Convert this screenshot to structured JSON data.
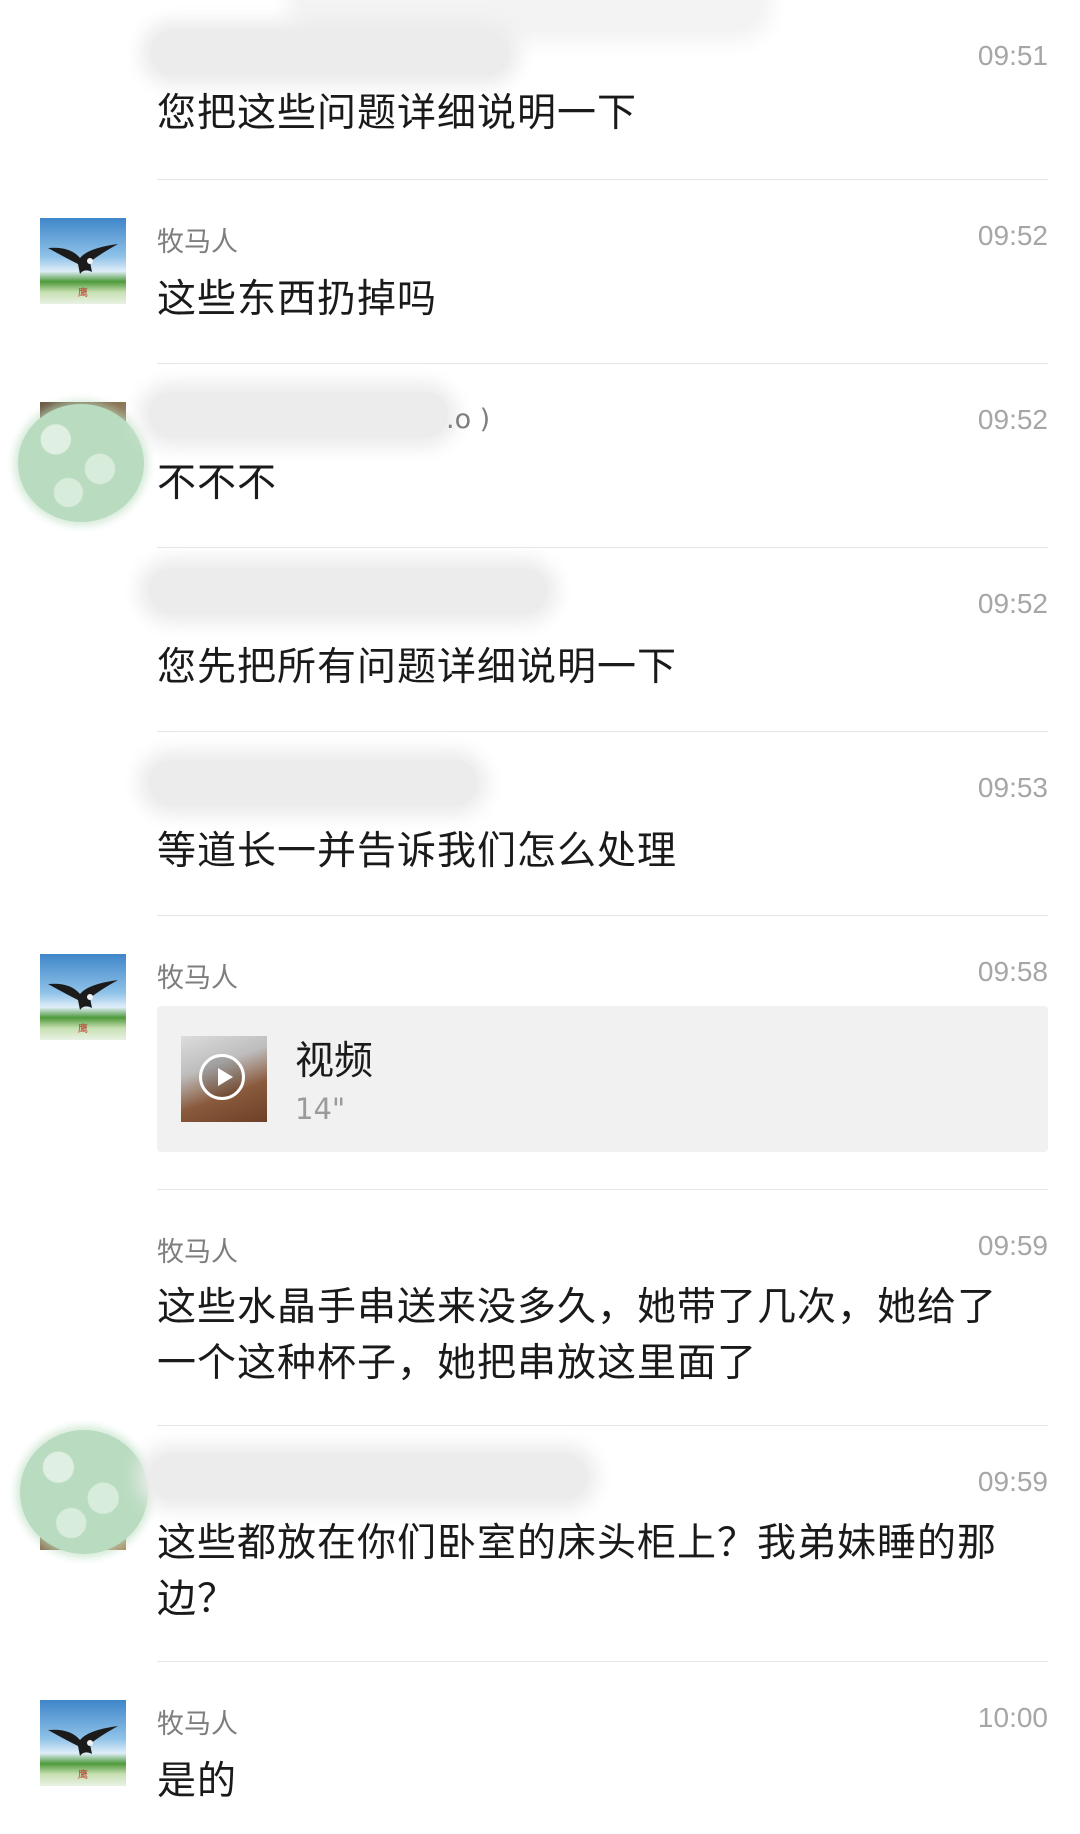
{
  "messages": [
    {
      "time": "09:51",
      "text": "您把这些问题详细说明一下"
    },
    {
      "sender": "牧马人",
      "time": "09:52",
      "text": "这些东西扔掉吗"
    },
    {
      "sender_fragment": ".o )",
      "time": "09:52",
      "text": "不不不"
    },
    {
      "time": "09:52",
      "text": "您先把所有问题详细说明一下"
    },
    {
      "time": "09:53",
      "text": "等道长一并告诉我们怎么处理"
    },
    {
      "sender": "牧马人",
      "time": "09:58",
      "video": {
        "label": "视频",
        "duration": "14\""
      }
    },
    {
      "sender": "牧马人",
      "time": "09:59",
      "text": [
        "这些水晶手串送来没多久，她带了几次，她给了",
        "一个这种杯子，她把串放这里面了"
      ]
    },
    {
      "time": "09:59",
      "text": [
        "这些都放在你们卧室的床头柜上？我弟妹睡的那",
        "边？"
      ]
    },
    {
      "sender": "牧马人",
      "time": "10:00",
      "text": "是的"
    }
  ]
}
